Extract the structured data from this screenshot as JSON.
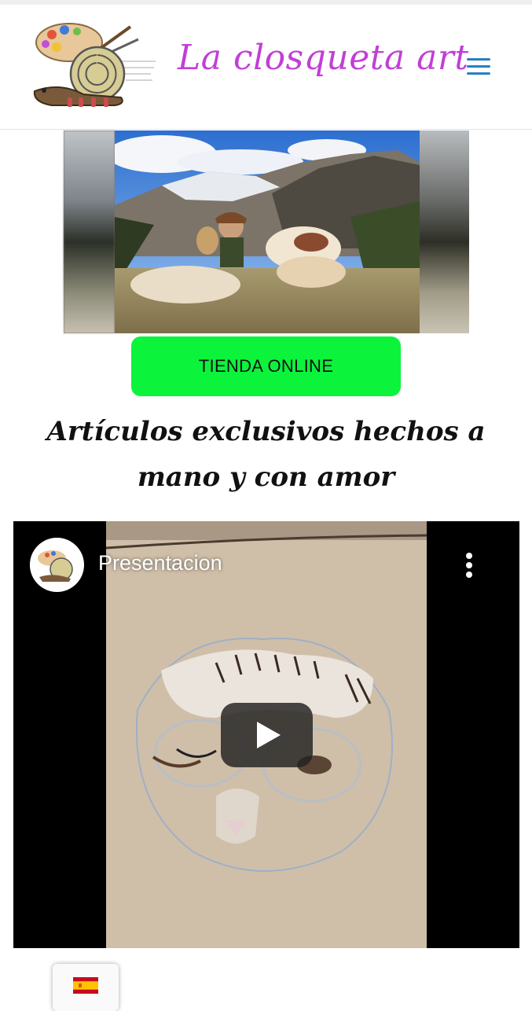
{
  "header": {
    "brand": "La closqueta art",
    "logo_icon": "snail-palette-logo-icon",
    "menu_icon": "hamburger-menu-icon"
  },
  "hero": {
    "image_alt": "Mujer con perros en la montaña nevada"
  },
  "shop_button": {
    "label": "TIENDA ONLINE",
    "color": "#0cf33c"
  },
  "tagline": "Artículos exclusivos hechos a mano y con amor",
  "video": {
    "title": "Presentacion",
    "more_icon": "more-vertical-icon",
    "play_icon": "play-icon"
  },
  "language": {
    "flag": "spain-flag-icon"
  },
  "colors": {
    "brand": "#c13fd6",
    "menu": "#2a7fbf",
    "button": "#0cf33c"
  }
}
